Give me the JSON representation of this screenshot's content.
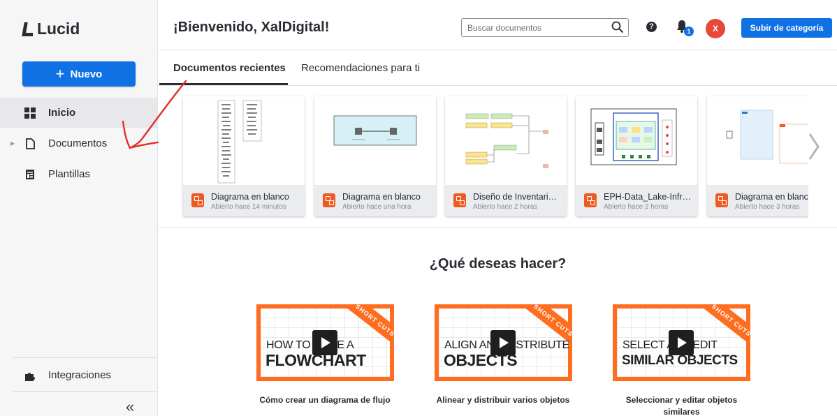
{
  "app": {
    "logo_text": "Lucid"
  },
  "sidebar": {
    "new_button": "Nuevo",
    "items": [
      {
        "label": "Inicio",
        "icon": "grid-icon"
      },
      {
        "label": "Documentos",
        "icon": "document-icon"
      },
      {
        "label": "Plantillas",
        "icon": "template-icon"
      }
    ],
    "integrations": "Integraciones",
    "collapse": "«"
  },
  "header": {
    "title": "¡Bienvenido, XalDigital!",
    "search_placeholder": "Buscar documentos",
    "help": "?",
    "notification_count": "1",
    "avatar_initial": "X",
    "cta": "Subir de categoría"
  },
  "tabs": [
    {
      "label": "Documentos recientes"
    },
    {
      "label": "Recomendaciones para ti"
    }
  ],
  "recent_documents": [
    {
      "title": "Diagrama en blanco",
      "time": "Abierto hace 14 minutos"
    },
    {
      "title": "Diagrama en blanco",
      "time": "Abierto hace una hora"
    },
    {
      "title": "Diseño de Inventari…",
      "time": "Abierto hace 2 horas"
    },
    {
      "title": "EPH-Data_Lake-Infr…",
      "time": "Abierto hace 2 horas"
    },
    {
      "title": "Diagrama en blanco",
      "time": "Abierto hace 3 horas"
    }
  ],
  "section": {
    "title": "¿Qué deseas hacer?",
    "videos": [
      {
        "line1": "HOW TO MAKE A",
        "line2": "FLOWCHART",
        "ribbon": "SHORT CUTS",
        "caption": "Cómo crear un diagrama de flujo"
      },
      {
        "line1": "ALIGN AND DISTRIBUTE",
        "line2": "OBJECTS",
        "ribbon": "SHORT CUTS",
        "caption": "Alinear y distribuir varios objetos"
      },
      {
        "line1": "SELECT AND EDIT",
        "line2": "SIMILAR OBJECTS",
        "ribbon": "SHORT CUTS",
        "caption": "Seleccionar y editar objetos similares"
      }
    ]
  },
  "colors": {
    "accent": "#1071e5",
    "doc_icon": "#f05a22",
    "video_orange": "#ff6d1f",
    "annotation_arrow": "#e0302a",
    "avatar": "#e8473a"
  }
}
